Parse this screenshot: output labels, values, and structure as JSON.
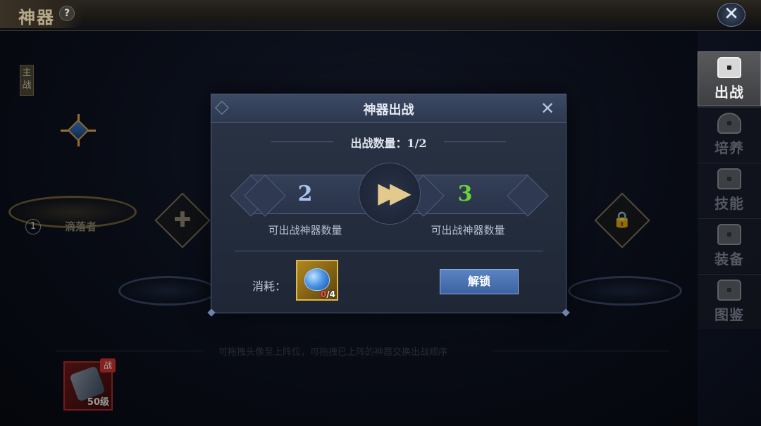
{
  "header": {
    "title": "神器",
    "help_icon": "?",
    "close_icon": "✕"
  },
  "side_tabs": [
    {
      "label": "出战",
      "icon": "chest-icon",
      "active": true
    },
    {
      "label": "培养",
      "icon": "bag-icon",
      "active": false
    },
    {
      "label": "技能",
      "icon": "chest-icon",
      "active": false
    },
    {
      "label": "装备",
      "icon": "chest-icon",
      "active": false
    },
    {
      "label": "图鉴",
      "icon": "chest-icon",
      "active": false
    }
  ],
  "backdrop": {
    "main_tag": "主战",
    "slot_number": "1",
    "hero_name": "滴落者",
    "hint": "可拖拽头像至上阵位，可拖拽已上阵的神器交换出战顺序",
    "hero_card": {
      "badge": "战",
      "level": "50级"
    }
  },
  "modal": {
    "title": "神器出战",
    "count_text": "出战数量：1/2",
    "current_value": "2",
    "next_value": "3",
    "current_label": "可出战神器数量",
    "next_label": "可出战神器数量",
    "arrow": "▶▶",
    "cost_label": "消耗：",
    "cost_item": {
      "icon": "blue-gem-icon",
      "have": "0",
      "need": "/4"
    },
    "unlock_button": "解锁"
  },
  "colors": {
    "next_value": "#69d13a",
    "current_value": "#a9c3ee",
    "insufficient": "#ff4d4d"
  }
}
